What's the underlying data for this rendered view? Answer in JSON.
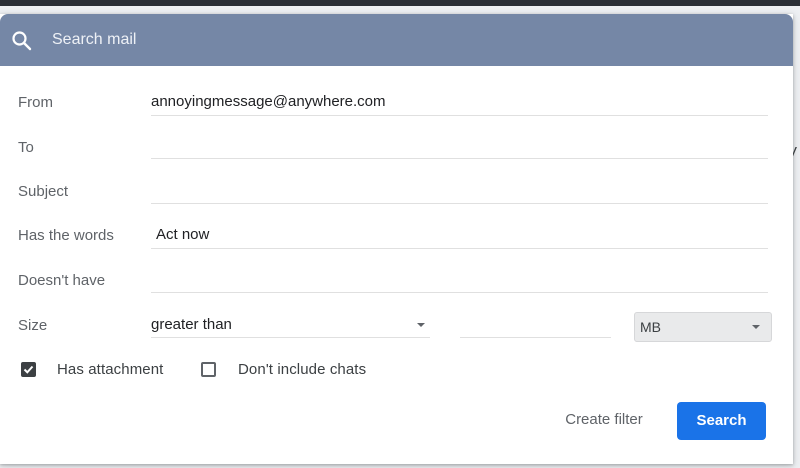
{
  "search": {
    "placeholder": "Search mail"
  },
  "form": {
    "from": {
      "label": "From",
      "value": "annoyingmessage@anywhere.com"
    },
    "to": {
      "label": "To",
      "value": ""
    },
    "subject": {
      "label": "Subject",
      "value": ""
    },
    "has_words": {
      "label": "Has the words",
      "value": "Act now"
    },
    "doesnt_have": {
      "label": "Doesn't have",
      "value": ""
    },
    "size": {
      "label": "Size",
      "comparator": "greater than",
      "amount": "",
      "unit": "MB"
    }
  },
  "options": {
    "has_attachment": {
      "label": "Has attachment",
      "checked": true
    },
    "dont_include_chats": {
      "label": "Don't include chats",
      "checked": false
    }
  },
  "actions": {
    "create_filter": "Create filter",
    "search": "Search"
  },
  "background": {
    "glyph": "V"
  },
  "icons": {
    "search": "search-icon",
    "dropdown": "chevron-down-icon",
    "check": "check-icon"
  },
  "colors": {
    "header": "#7587a6",
    "primary": "#1a73e8"
  }
}
